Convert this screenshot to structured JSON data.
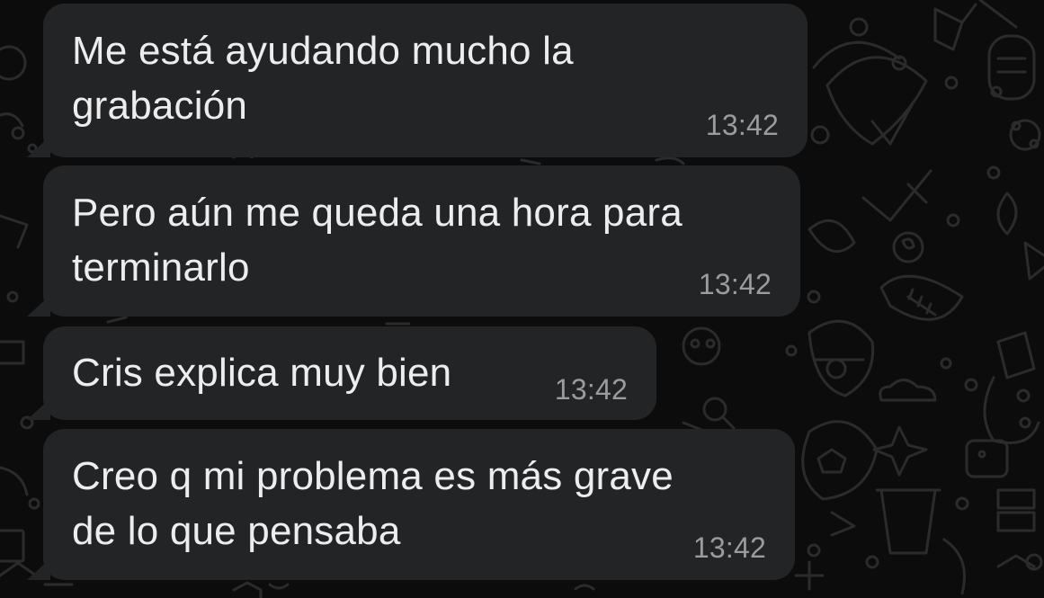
{
  "conversation": {
    "messages": [
      {
        "text": "Me está ayudando mucho la\ngrabación",
        "time": "13:42"
      },
      {
        "text": "Pero aún me queda una hora para\nterminarlo",
        "time": "13:42"
      },
      {
        "text": "Cris explica muy bien",
        "time": "13:42"
      },
      {
        "text": "Creo q mi problema es más grave\nde lo que pensaba",
        "time": "13:42"
      }
    ]
  },
  "theme": {
    "background": "#0c0c0c",
    "bubble": "#222426",
    "text": "#ededed",
    "timestamp": "#9a9c9e",
    "doodle": "#2a2a2a"
  }
}
